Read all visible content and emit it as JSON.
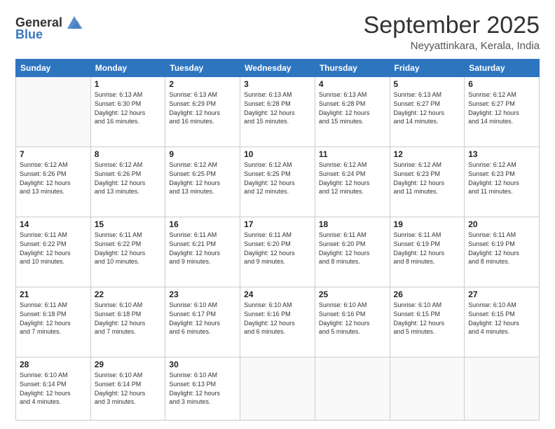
{
  "logo": {
    "general": "General",
    "blue": "Blue"
  },
  "header": {
    "month": "September 2025",
    "location": "Neyyattinkara, Kerala, India"
  },
  "weekdays": [
    "Sunday",
    "Monday",
    "Tuesday",
    "Wednesday",
    "Thursday",
    "Friday",
    "Saturday"
  ],
  "days": [
    {
      "date": null,
      "info": null
    },
    {
      "date": "1",
      "info": "Sunrise: 6:13 AM\nSunset: 6:30 PM\nDaylight: 12 hours\nand 16 minutes."
    },
    {
      "date": "2",
      "info": "Sunrise: 6:13 AM\nSunset: 6:29 PM\nDaylight: 12 hours\nand 16 minutes."
    },
    {
      "date": "3",
      "info": "Sunrise: 6:13 AM\nSunset: 6:28 PM\nDaylight: 12 hours\nand 15 minutes."
    },
    {
      "date": "4",
      "info": "Sunrise: 6:13 AM\nSunset: 6:28 PM\nDaylight: 12 hours\nand 15 minutes."
    },
    {
      "date": "5",
      "info": "Sunrise: 6:13 AM\nSunset: 6:27 PM\nDaylight: 12 hours\nand 14 minutes."
    },
    {
      "date": "6",
      "info": "Sunrise: 6:12 AM\nSunset: 6:27 PM\nDaylight: 12 hours\nand 14 minutes."
    },
    {
      "date": "7",
      "info": "Sunrise: 6:12 AM\nSunset: 6:26 PM\nDaylight: 12 hours\nand 13 minutes."
    },
    {
      "date": "8",
      "info": "Sunrise: 6:12 AM\nSunset: 6:26 PM\nDaylight: 12 hours\nand 13 minutes."
    },
    {
      "date": "9",
      "info": "Sunrise: 6:12 AM\nSunset: 6:25 PM\nDaylight: 12 hours\nand 13 minutes."
    },
    {
      "date": "10",
      "info": "Sunrise: 6:12 AM\nSunset: 6:25 PM\nDaylight: 12 hours\nand 12 minutes."
    },
    {
      "date": "11",
      "info": "Sunrise: 6:12 AM\nSunset: 6:24 PM\nDaylight: 12 hours\nand 12 minutes."
    },
    {
      "date": "12",
      "info": "Sunrise: 6:12 AM\nSunset: 6:23 PM\nDaylight: 12 hours\nand 11 minutes."
    },
    {
      "date": "13",
      "info": "Sunrise: 6:12 AM\nSunset: 6:23 PM\nDaylight: 12 hours\nand 11 minutes."
    },
    {
      "date": "14",
      "info": "Sunrise: 6:11 AM\nSunset: 6:22 PM\nDaylight: 12 hours\nand 10 minutes."
    },
    {
      "date": "15",
      "info": "Sunrise: 6:11 AM\nSunset: 6:22 PM\nDaylight: 12 hours\nand 10 minutes."
    },
    {
      "date": "16",
      "info": "Sunrise: 6:11 AM\nSunset: 6:21 PM\nDaylight: 12 hours\nand 9 minutes."
    },
    {
      "date": "17",
      "info": "Sunrise: 6:11 AM\nSunset: 6:20 PM\nDaylight: 12 hours\nand 9 minutes."
    },
    {
      "date": "18",
      "info": "Sunrise: 6:11 AM\nSunset: 6:20 PM\nDaylight: 12 hours\nand 8 minutes."
    },
    {
      "date": "19",
      "info": "Sunrise: 6:11 AM\nSunset: 6:19 PM\nDaylight: 12 hours\nand 8 minutes."
    },
    {
      "date": "20",
      "info": "Sunrise: 6:11 AM\nSunset: 6:19 PM\nDaylight: 12 hours\nand 8 minutes."
    },
    {
      "date": "21",
      "info": "Sunrise: 6:11 AM\nSunset: 6:18 PM\nDaylight: 12 hours\nand 7 minutes."
    },
    {
      "date": "22",
      "info": "Sunrise: 6:10 AM\nSunset: 6:18 PM\nDaylight: 12 hours\nand 7 minutes."
    },
    {
      "date": "23",
      "info": "Sunrise: 6:10 AM\nSunset: 6:17 PM\nDaylight: 12 hours\nand 6 minutes."
    },
    {
      "date": "24",
      "info": "Sunrise: 6:10 AM\nSunset: 6:16 PM\nDaylight: 12 hours\nand 6 minutes."
    },
    {
      "date": "25",
      "info": "Sunrise: 6:10 AM\nSunset: 6:16 PM\nDaylight: 12 hours\nand 5 minutes."
    },
    {
      "date": "26",
      "info": "Sunrise: 6:10 AM\nSunset: 6:15 PM\nDaylight: 12 hours\nand 5 minutes."
    },
    {
      "date": "27",
      "info": "Sunrise: 6:10 AM\nSunset: 6:15 PM\nDaylight: 12 hours\nand 4 minutes."
    },
    {
      "date": "28",
      "info": "Sunrise: 6:10 AM\nSunset: 6:14 PM\nDaylight: 12 hours\nand 4 minutes."
    },
    {
      "date": "29",
      "info": "Sunrise: 6:10 AM\nSunset: 6:14 PM\nDaylight: 12 hours\nand 3 minutes."
    },
    {
      "date": "30",
      "info": "Sunrise: 6:10 AM\nSunset: 6:13 PM\nDaylight: 12 hours\nand 3 minutes."
    },
    {
      "date": null,
      "info": null
    },
    {
      "date": null,
      "info": null
    },
    {
      "date": null,
      "info": null
    },
    {
      "date": null,
      "info": null
    }
  ]
}
